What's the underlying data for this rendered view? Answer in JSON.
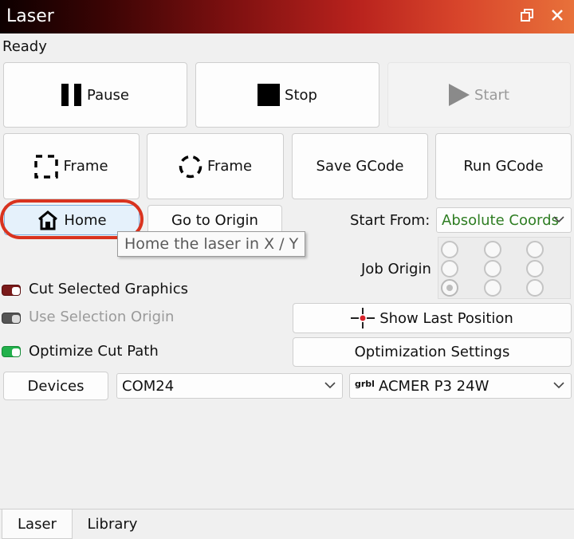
{
  "window": {
    "title": "Laser",
    "restore_icon": "restore-window-icon",
    "close_icon": "close-icon"
  },
  "status": "Ready",
  "controls": {
    "pause": "Pause",
    "stop": "Stop",
    "start": "Start",
    "frame_rect": "Frame",
    "frame_circle": "Frame",
    "save_gcode": "Save GCode",
    "run_gcode": "Run GCode",
    "home": "Home",
    "go_to_origin": "Go to Origin"
  },
  "tooltip": "Home the laser in X / Y",
  "start_from": {
    "label": "Start From:",
    "value": "Absolute Coords"
  },
  "job_origin": {
    "label": "Job Origin",
    "selected_index": 6
  },
  "options": {
    "cut_selected": {
      "label": "Cut Selected Graphics",
      "state": "on",
      "color": "#7a1a1a"
    },
    "use_selection_origin": {
      "label": "Use Selection Origin",
      "state": "disabled",
      "color": "#555555"
    },
    "optimize_cut_path": {
      "label": "Optimize Cut Path",
      "state": "on",
      "color": "#22b14c"
    }
  },
  "show_last_position": "Show Last Position",
  "optimization_settings": "Optimization Settings",
  "devices": {
    "button": "Devices",
    "port": "COM24",
    "device_prefix": "grbl",
    "device": "ACMER P3 24W"
  },
  "tabs": [
    "Laser",
    "Library"
  ],
  "colors": {
    "accent_ring": "#d9331f",
    "home_bg": "#e5f1fb",
    "start_from_text": "#2e7d22"
  }
}
